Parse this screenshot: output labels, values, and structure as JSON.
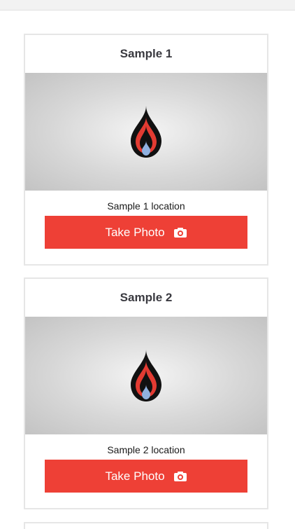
{
  "cards": [
    {
      "title": "Sample 1",
      "location": "Sample 1 location",
      "button_label": "Take Photo",
      "logo_icon": "flame-drop-logo",
      "button_icon": "camera-icon"
    },
    {
      "title": "Sample 2",
      "location": "Sample 2 location",
      "button_label": "Take Photo",
      "logo_icon": "flame-drop-logo",
      "button_icon": "camera-icon"
    }
  ],
  "colors": {
    "accent": "#ee4036",
    "logo_black": "#111111",
    "logo_red": "#e33b32",
    "logo_drop": "#8fb1e0"
  }
}
